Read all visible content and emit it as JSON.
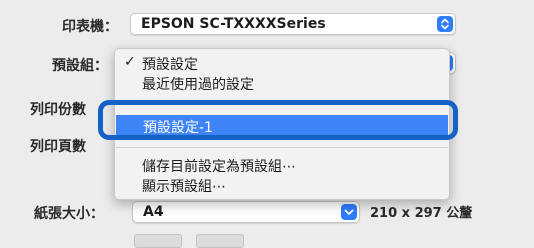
{
  "printer": {
    "label": "印表機：",
    "value": "EPSON SC-TXXXXSeries"
  },
  "presets": {
    "label": "預設組：",
    "menu": {
      "check_mark": "✓",
      "items": [
        {
          "label": "預設設定",
          "checked": true
        },
        {
          "label": "最近使用過的設定",
          "checked": false
        },
        {
          "label": "預設設定-1",
          "selected": true
        },
        {
          "label": "儲存目前設定為預設組⋯"
        },
        {
          "label": "顯示預設組⋯"
        }
      ]
    }
  },
  "copies": {
    "label": "列印份數"
  },
  "pages": {
    "label": "列印頁數"
  },
  "paper_size": {
    "label": "紙張大小：",
    "value": "A4",
    "dimensions": "210 x 297 公釐"
  },
  "colors": {
    "accent": "#2f7dfc",
    "menu_highlight": "#3f84f7",
    "focus_ring": "#1461c8"
  },
  "icons": {
    "popup_arrows": "up-down-chevron-icon",
    "dropdown_arrow": "chevron-down-icon"
  }
}
